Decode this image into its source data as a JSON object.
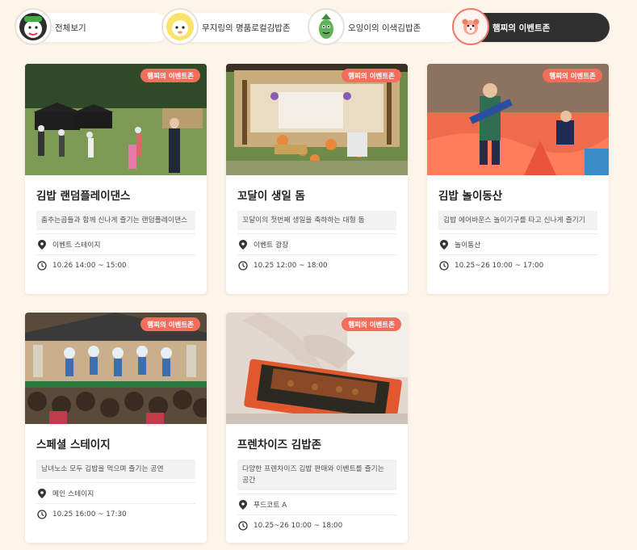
{
  "tabs": [
    {
      "label": "전체보기",
      "icon": "character-all-icon",
      "active": false
    },
    {
      "label": "무지링의 명품로컬김밥존",
      "icon": "character-mujiring-icon",
      "active": false
    },
    {
      "label": "오잉이의 이색김밥존",
      "icon": "character-oing-icon",
      "active": false
    },
    {
      "label": "햄찌의 이벤트존",
      "icon": "character-hamjji-icon",
      "active": true
    }
  ],
  "badge_label": "햄찌의 이벤트존",
  "cards": [
    {
      "title": "김밥 랜덤플레이댄스",
      "desc": "춤추는곰들과 함께 신나게 즐기는 랜덤플레이댄스",
      "location": "이벤트 스테이지",
      "time": "10.26 14:00 ~ 15:00"
    },
    {
      "title": "꼬달이 생일 돔",
      "desc": "꼬달이의 첫번째 생일을 축하하는 대형 돔",
      "location": "이벤트 광장",
      "time": "10.25 12:00 ~ 18:00"
    },
    {
      "title": "김밥 놀이동산",
      "desc": "김밥 에어바운스 놀이기구를 타고 신나게 즐기기",
      "location": "놀이동산",
      "time": "10.25~26 10:00 ~ 17:00"
    },
    {
      "title": "스페셜 스테이지",
      "desc": "남녀노소 모두 김밥을 먹으며 즐기는 공연",
      "location": "메인 스테이지",
      "time": "10.25 16:00 ~ 17:30"
    },
    {
      "title": "프렌차이즈 김밥존",
      "desc": "다양한 프렌차이즈 김밥 판매와 이벤트를 즐기는 공간",
      "location": "푸드코트 A",
      "time": "10.25~26 10:00 ~ 18:00"
    }
  ],
  "colors": {
    "accent": "#f26e5a",
    "active_tab": "#2f2f2f",
    "background": "#fdf4ea"
  }
}
